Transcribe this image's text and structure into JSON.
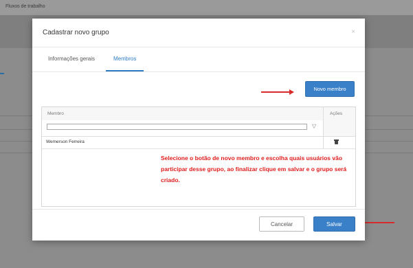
{
  "app": {
    "top_bar_title": "Fluxos de trabalho"
  },
  "modal": {
    "title": "Cadastrar novo grupo",
    "close_symbol": "×",
    "tabs": [
      {
        "label": "Informações gerais",
        "active": false
      },
      {
        "label": "Membros",
        "active": true
      }
    ],
    "new_member_button": "Novo membro",
    "grid": {
      "columns": [
        "Membro",
        "Ações"
      ],
      "filter": {
        "value": "",
        "placeholder": "",
        "icon": "filter-icon"
      },
      "rows": [
        {
          "member": "Wemerson Ferreira",
          "action_icon": "trash-icon"
        }
      ]
    },
    "annotation": "Selecione o botão de novo membro e escolha quais usuários vão participar desse grupo, ao finalizar clique em salvar e o grupo será criado.",
    "footer": {
      "cancel_label": "Cancelar",
      "save_label": "Salvar"
    }
  },
  "colors": {
    "primary": "#3a80c8",
    "tab_active": "#2e7bc4",
    "annotation": "#e01b1b",
    "overlay": "#8c8c8c"
  }
}
